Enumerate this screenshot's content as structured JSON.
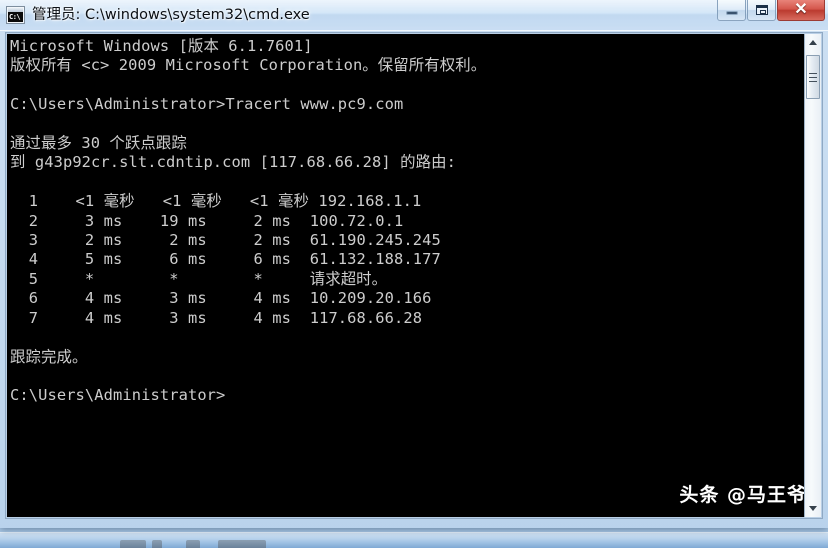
{
  "window": {
    "title": "管理员: C:\\windows\\system32\\cmd.exe",
    "icon_name": "cmd-console-icon",
    "icon_text": "C:\\",
    "controls": {
      "minimize_label": "最小化",
      "restore_label": "向下还原",
      "close_label": "关闭",
      "close_glyph": "✕"
    }
  },
  "console": {
    "text": "Microsoft Windows [版本 6.1.7601]\n版权所有 <c> 2009 Microsoft Corporation。保留所有权利。\n\nC:\\Users\\Administrator>Tracert www.pc9.com\n\n通过最多 30 个跃点跟踪\n到 g43p92cr.slt.cdntip.com [117.68.66.28] 的路由:\n\n  1    <1 毫秒   <1 毫秒   <1 毫秒 192.168.1.1\n  2     3 ms    19 ms     2 ms  100.72.0.1\n  3     2 ms     2 ms     2 ms  61.190.245.245\n  4     5 ms     6 ms     6 ms  61.132.188.177\n  5     *        *        *     请求超时。\n  6     4 ms     3 ms     4 ms  10.209.20.166\n  7     4 ms     3 ms     4 ms  117.68.66.28\n\n跟踪完成。\n\nC:\\Users\\Administrator>",
    "lines": [
      "Microsoft Windows [版本 6.1.7601]",
      "版权所有 <c> 2009 Microsoft Corporation。保留所有权利。",
      "",
      "C:\\Users\\Administrator>Tracert www.pc9.com",
      "",
      "通过最多 30 个跃点跟踪",
      "到 g43p92cr.slt.cdntip.com [117.68.66.28] 的路由:",
      "",
      "  1    <1 毫秒   <1 毫秒   <1 毫秒 192.168.1.1",
      "  2     3 ms    19 ms     2 ms  100.72.0.1",
      "  3     2 ms     2 ms     2 ms  61.190.245.245",
      "  4     5 ms     6 ms     6 ms  61.132.188.177",
      "  5     *        *        *     请求超时。",
      "  6     4 ms     3 ms     4 ms  10.209.20.166",
      "  7     4 ms     3 ms     4 ms  117.68.66.28",
      "",
      "跟踪完成。",
      "",
      "C:\\Users\\Administrator>"
    ],
    "header": {
      "os_line": "Microsoft Windows [版本 6.1.7601]",
      "copyright_line": "版权所有 <c> 2009 Microsoft Corporation。保留所有权利。"
    },
    "command": {
      "prompt": "C:\\Users\\Administrator>",
      "entered": "Tracert www.pc9.com"
    },
    "tracert": {
      "max_hops_line": "通过最多 30 个跃点跟踪",
      "target_line": "到 g43p92cr.slt.cdntip.com [117.68.66.28] 的路由:",
      "max_hops": 30,
      "target_host": "g43p92cr.slt.cdntip.com",
      "target_ip": "117.68.66.28",
      "timeout_text": "请求超时。",
      "complete_line": "跟踪完成。",
      "hops": [
        {
          "hop": "1",
          "rtt1": "<1 毫秒",
          "rtt2": "<1 毫秒",
          "rtt3": "<1 毫秒",
          "host": "192.168.1.1"
        },
        {
          "hop": "2",
          "rtt1": "3 ms",
          "rtt2": "19 ms",
          "rtt3": "2 ms",
          "host": "100.72.0.1"
        },
        {
          "hop": "3",
          "rtt1": "2 ms",
          "rtt2": "2 ms",
          "rtt3": "2 ms",
          "host": "61.190.245.245"
        },
        {
          "hop": "4",
          "rtt1": "5 ms",
          "rtt2": "6 ms",
          "rtt3": "6 ms",
          "host": "61.132.188.177"
        },
        {
          "hop": "5",
          "rtt1": "*",
          "rtt2": "*",
          "rtt3": "*",
          "host": "请求超时。"
        },
        {
          "hop": "6",
          "rtt1": "4 ms",
          "rtt2": "3 ms",
          "rtt3": "4 ms",
          "host": "10.209.20.166"
        },
        {
          "hop": "7",
          "rtt1": "4 ms",
          "rtt2": "3 ms",
          "rtt3": "4 ms",
          "host": "117.68.66.28"
        }
      ]
    },
    "final_prompt": "C:\\Users\\Administrator>"
  },
  "watermark": {
    "text": "头条 @马王爷"
  },
  "scrollbar": {
    "up_arrow_name": "scroll-up-arrow",
    "down_arrow_name": "scroll-down-arrow"
  },
  "colors": {
    "console_background": "#000000",
    "console_text": "#cdcdcd",
    "titlebar_glass": "#cde0f3",
    "close_button_red": "#bb3a2f",
    "desktop": "#c3d9ef"
  }
}
